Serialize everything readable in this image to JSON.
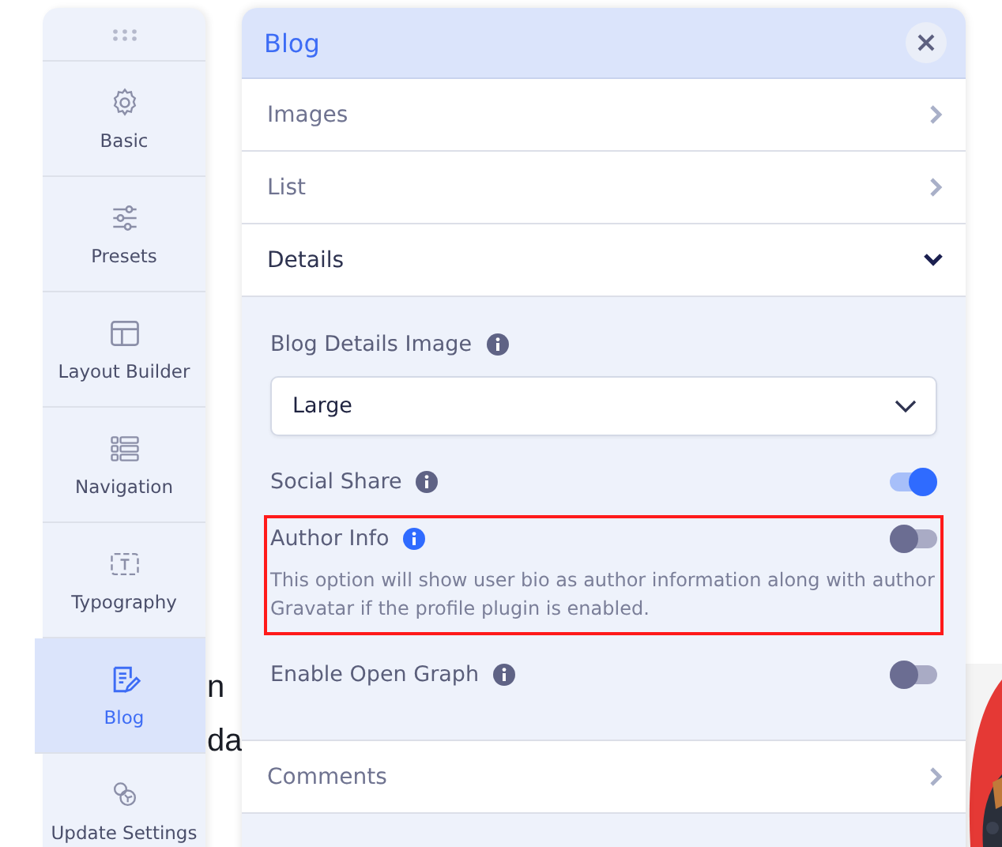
{
  "background_page": {
    "body_lines": [
      "n",
      "da"
    ]
  },
  "sidebar": {
    "items": [
      {
        "label": "Basic",
        "selected": false
      },
      {
        "label": "Presets",
        "selected": false
      },
      {
        "label": "Layout Builder",
        "selected": false
      },
      {
        "label": "Navigation",
        "selected": false
      },
      {
        "label": "Typography",
        "selected": false
      },
      {
        "label": "Blog",
        "selected": true
      },
      {
        "label": "Update Settings",
        "selected": false
      }
    ]
  },
  "panel": {
    "title": "Blog",
    "sections": [
      {
        "label": "Images",
        "expanded": false
      },
      {
        "label": "List",
        "expanded": false
      },
      {
        "label": "Details",
        "expanded": true,
        "fields": [
          {
            "kind": "select",
            "label": "Blog Details Image",
            "value": "Large",
            "highlighted": false
          },
          {
            "kind": "toggle",
            "label": "Social Share",
            "on": true,
            "highlighted": false
          },
          {
            "kind": "toggle",
            "label": "Author Info",
            "on": false,
            "highlighted": true,
            "description": "This option will show user bio as author information along with author Gravatar if the profile plugin is enabled."
          },
          {
            "kind": "toggle",
            "label": "Enable Open Graph",
            "on": false,
            "highlighted": false
          }
        ]
      },
      {
        "label": "Comments",
        "expanded": false
      }
    ]
  }
}
